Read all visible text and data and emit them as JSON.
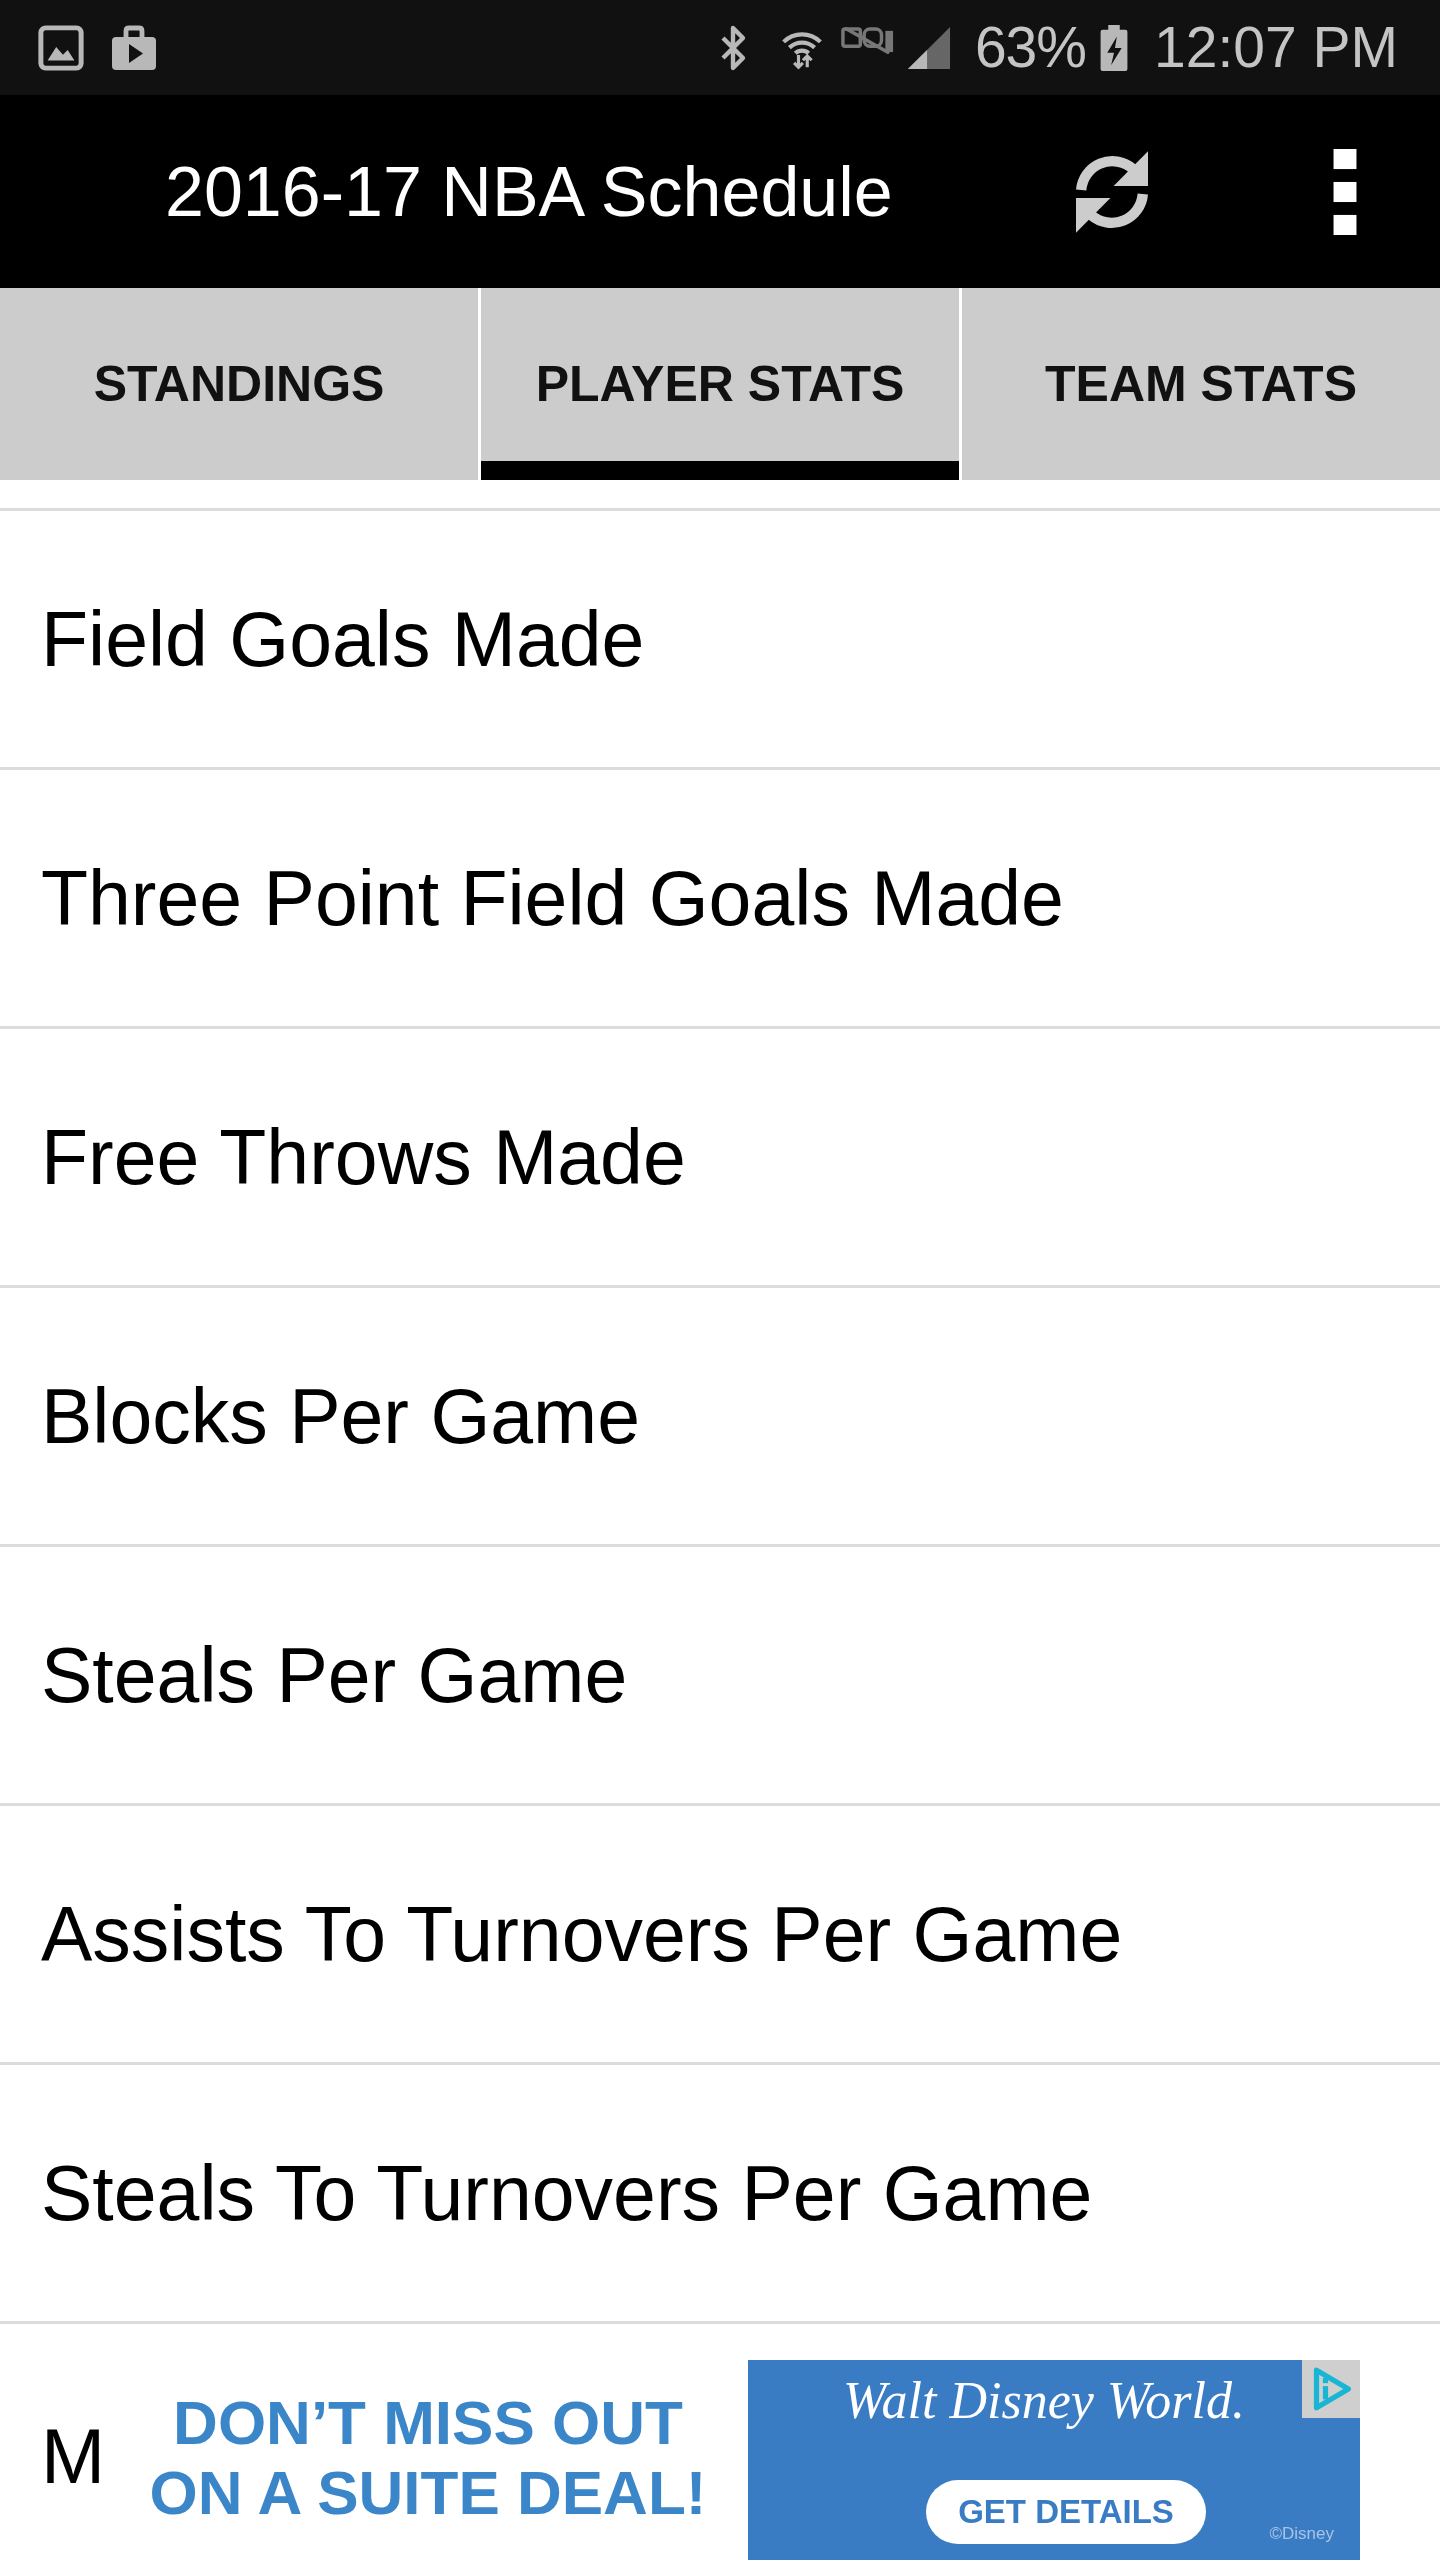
{
  "status_bar": {
    "battery_percent": "63%",
    "time": "12:07 PM"
  },
  "app_bar": {
    "title": "2016-17 NBA Schedule"
  },
  "tabs": [
    {
      "label": "STANDINGS",
      "selected": false
    },
    {
      "label": "PLAYER STATS",
      "selected": true
    },
    {
      "label": "TEAM STATS",
      "selected": false
    }
  ],
  "stat_categories": [
    "Field Goals Made",
    "Three Point Field Goals Made",
    "Free Throws Made",
    "Blocks Per Game",
    "Steals Per Game",
    "Assists To Turnovers Per Game",
    "Steals To Turnovers Per Game",
    "M"
  ],
  "ad_banner": {
    "headline": "DON’T MISS OUT ON A SUITE DEAL!",
    "brand": "Walt Disney World.",
    "button": "GET DETAILS",
    "credit": "©Disney"
  }
}
